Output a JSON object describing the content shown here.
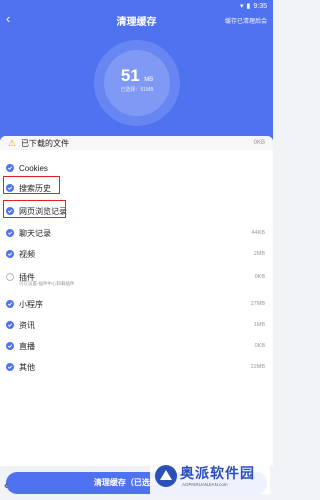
{
  "status": {
    "time": "9:35"
  },
  "header": {
    "title": "清理缓存",
    "top_right": "缓存已清理后会",
    "size_value": "51",
    "size_unit": "MB",
    "size_sub": "已选择：51MB"
  },
  "downloads": {
    "label": "已下载的文件",
    "size": "0KB"
  },
  "rows": [
    {
      "label": "Cookies",
      "size": "",
      "checked": true
    },
    {
      "label": "搜索历史",
      "size": "",
      "checked": true
    },
    {
      "label": "网页浏览记录",
      "size": "",
      "checked": true
    },
    {
      "label": "聊天记录",
      "size": "44KB",
      "checked": true
    },
    {
      "label": "视频",
      "size": "2MB",
      "checked": true
    },
    {
      "label": "插件",
      "sub": "可在设置-插件中心卸载插件",
      "size": "0KB",
      "checked": false
    },
    {
      "label": "小程序",
      "size": "27MB",
      "checked": true
    },
    {
      "label": "资讯",
      "size": "1MB",
      "checked": true
    },
    {
      "label": "直播",
      "size": "0KB",
      "checked": true
    },
    {
      "label": "其他",
      "size": "22MB",
      "checked": true
    }
  ],
  "bottom_button": "清理缓存（已选51MB）",
  "watermark": {
    "name": "奥派软件园",
    "url": "AOPAIRUANJIAN.com"
  },
  "colors": {
    "primary": "#4f73f0",
    "highlight": "#e0231f",
    "warning": "#f5a623"
  }
}
